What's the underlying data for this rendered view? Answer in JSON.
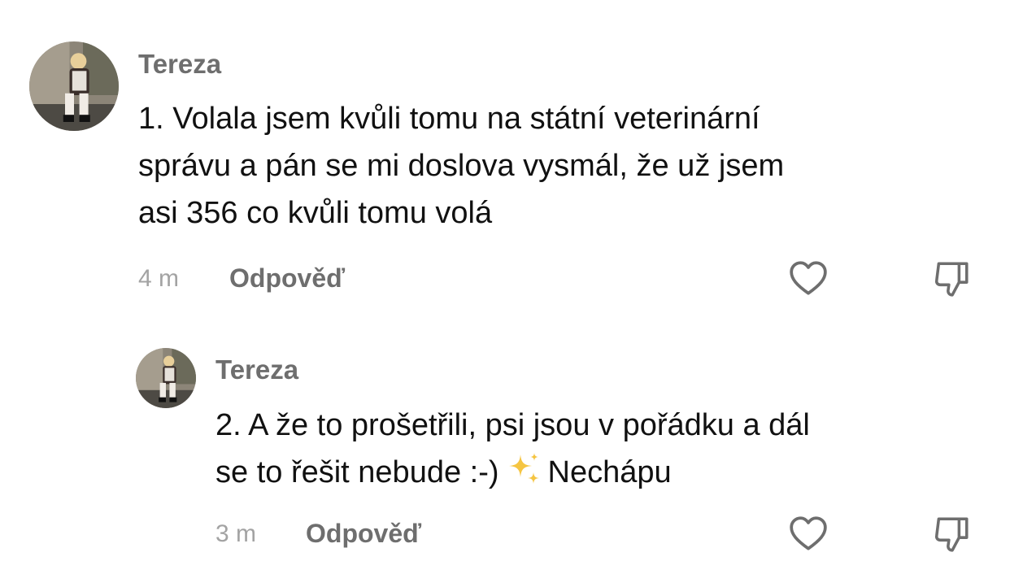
{
  "comments": [
    {
      "author": "Tereza",
      "text": "1. Volala jsem kvůli tomu na státní veterinární\nsprávu a pán se mi doslova vysmál, že už jsem\nasi 356 co kvůli tomu volá",
      "time": "4 m",
      "reply_label": "Odpověď"
    },
    {
      "author": "Tereza",
      "text_before_emoji": "2. A že to prošetřili, psi jsou v pořádku a dál\nse to řešit nebude :-)",
      "emoji": "sparkles-emoji",
      "text_after_emoji": "Nechápu",
      "time": "3 m",
      "reply_label": "Odpověď"
    }
  ],
  "icons": {
    "like": "heart-outline-icon",
    "dislike": "thumbs-down-outline-icon"
  },
  "colors": {
    "author": "#6e6e6e",
    "text": "#111111",
    "time": "#a3a3a3",
    "icon": "#6e6e6e",
    "sparkle": "#f5c542"
  }
}
